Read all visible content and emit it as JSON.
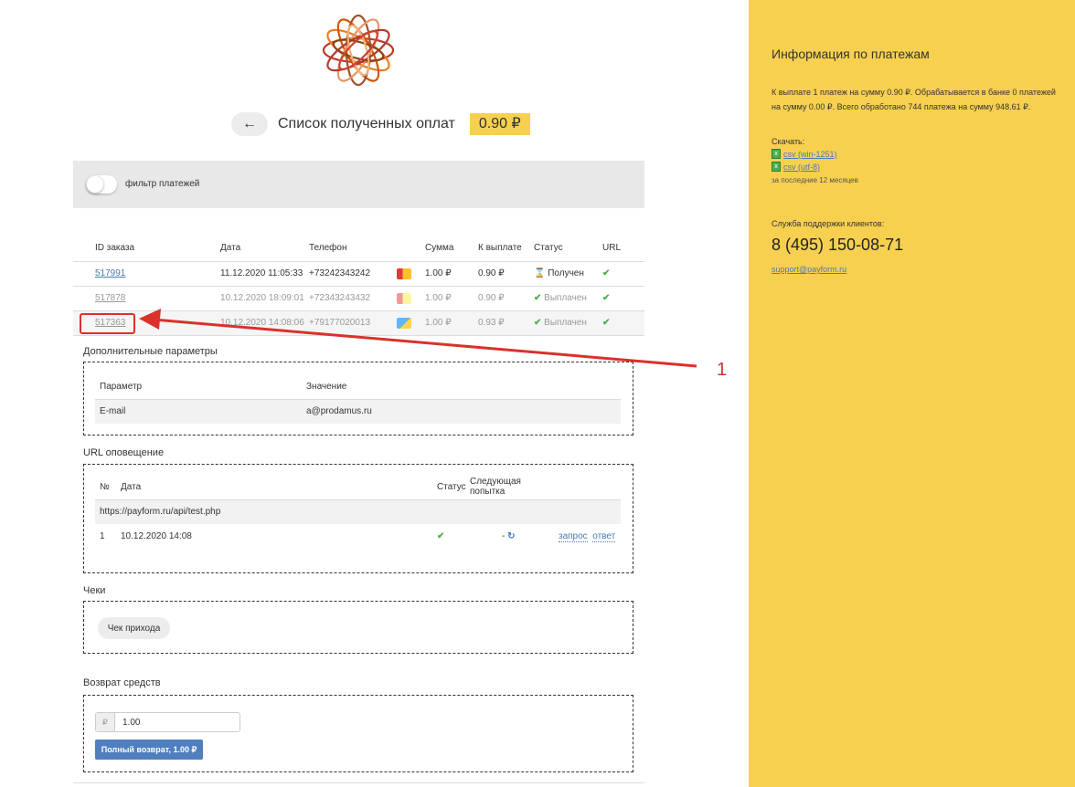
{
  "header": {
    "title": "Список полученных оплат",
    "amount": "0.90 ₽",
    "back_icon": "←"
  },
  "filter": {
    "label": "фильтр платежей"
  },
  "orders": {
    "columns": [
      "ID заказа",
      "Дата",
      "Телефон",
      "",
      "Сумма",
      "К выплате",
      "Статус",
      "URL"
    ],
    "rows": [
      {
        "id": "517991",
        "date": "11.12.2020 11:05:33",
        "phone": "+73242343242",
        "pay_icon": "yandex-icon",
        "sum": "1.00 ₽",
        "payout": "0.90 ₽",
        "status": "Получен",
        "status_icon": "hourglass-icon",
        "url_icon": "✔"
      },
      {
        "id": "517878",
        "date": "10.12.2020 18:09:01",
        "phone": "+72343243432",
        "pay_icon": "yandex-icon",
        "sum": "1.00 ₽",
        "payout": "0.90 ₽",
        "status": "Выплачен",
        "status_icon": "check-icon",
        "url_icon": "✔"
      },
      {
        "id": "517363",
        "date": "10.12.2020 14:08:06",
        "phone": "+79177020013",
        "pay_icon": "card-icon",
        "sum": "1.00 ₽",
        "payout": "0.93 ₽",
        "status": "Выплачен",
        "status_icon": "check-icon",
        "url_icon": "✔"
      }
    ]
  },
  "extra_params": {
    "label": "Дополнительные параметры",
    "col_param": "Параметр",
    "col_value": "Значение",
    "rows": [
      {
        "param": "E-mail",
        "value": "a@prodamus.ru"
      }
    ]
  },
  "url_notify": {
    "label": "URL оповещение",
    "col_no": "№",
    "col_date": "Дата",
    "col_status": "Статус",
    "col_next": "Следующая попытка",
    "url": "https://payform.ru/api/test.php",
    "rows": [
      {
        "no": "1",
        "date": "10.12.2020 14:08",
        "status_icon": "✔",
        "next": "-",
        "request": "запрос",
        "response": "ответ"
      }
    ]
  },
  "receipts": {
    "label": "Чеки",
    "button": "Чек прихода"
  },
  "refund": {
    "label": "Возврат средств",
    "currency": "₽",
    "value": "1.00",
    "button": "Полный возврат, 1.00 ₽"
  },
  "annotation": {
    "number": "1"
  },
  "sidebar": {
    "title": "Информация по платежам",
    "info": "К выплате 1 платеж на сумму 0.90 ₽. Обрабатывается в банке 0 платежей на сумму 0.00 ₽. Всего обработано 744 платежа на сумму 948.61 ₽.",
    "download_label": "Скачать:",
    "csv1": "csv (win-1251)",
    "csv2": "csv (utf-8)",
    "period_note": "за последние 12 месяцев",
    "support_label": "Служба поддержки клиентов:",
    "phone": "8 (495) 150-08-71",
    "email": "support@payform.ru"
  },
  "colors": {
    "accent_yellow": "#f7d04f",
    "link_blue": "#4a7ab8",
    "annotation_red": "#d9322c",
    "ok_green": "#4caf50",
    "button_blue": "#4f7fbf"
  }
}
